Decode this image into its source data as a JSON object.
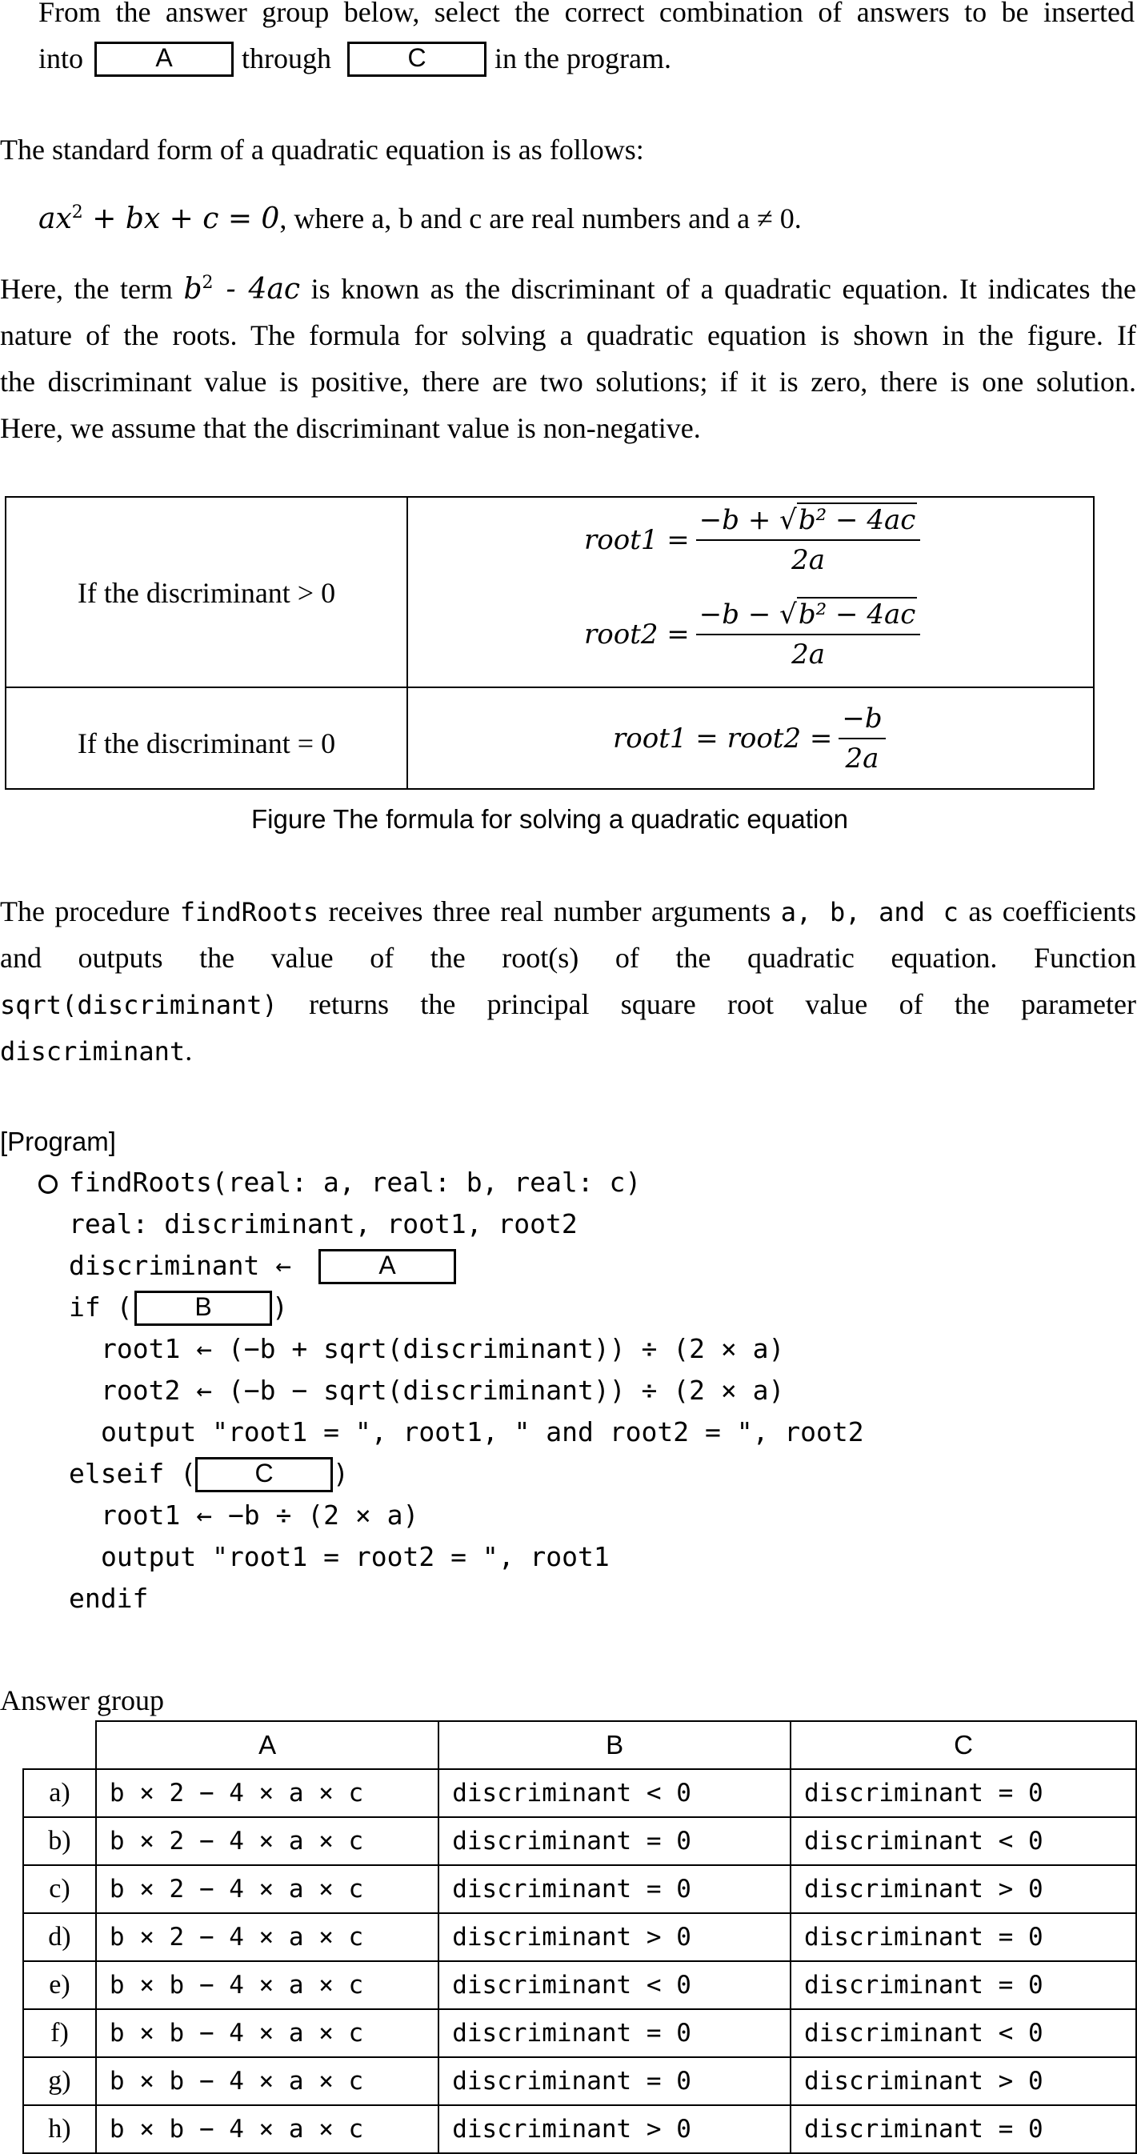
{
  "intro": {
    "line1": "From the answer group below, select the correct combination of answers to be inserted",
    "into": "into",
    "through": "through",
    "in_program": "in the program.",
    "blank_a": "A",
    "blank_c": "C"
  },
  "standard_form": {
    "heading": "The standard form of a quadratic equation is as follows:",
    "eq_text": ", where a, b and c are real numbers and a ≠ 0."
  },
  "discriminant_paragraph": {
    "line1_after": " is known as the discriminant of a quadratic equation. It indicates the",
    "line2": "nature of the roots. The formula for solving a quadratic equation is shown in the figure. If",
    "line3": "the discriminant value is positive, there are two solutions; if it is zero, there is one solution.",
    "line4": "Here, we assume that the discriminant value is non-negative."
  },
  "figure": {
    "row1_condition": "If the discriminant > 0",
    "row2_condition": "If the discriminant  = 0",
    "caption": "Figure  The formula for solving a quadratic equation"
  },
  "procedure_paragraph": {
    "line1_pre": "The procedure ",
    "name": "findRoots",
    "line1_mid": " receives three real number arguments ",
    "args": "a, b, and c",
    "line1_post": " as coefficients",
    "line2": "and outputs the value of the root(s) of the quadratic equation. Function",
    "line3_code": "sqrt(discriminant)",
    "line3": " returns the principal square root value of the parameter",
    "line4_code": "discriminant",
    "line4": "."
  },
  "program": {
    "label": "[Program]",
    "lines": [
      "findRoots(real: a, real: b, real: c)",
      "real: discriminant, root1, root2",
      "discriminant ←",
      "if (",
      ")",
      "root1 ← (−b + sqrt(discriminant)) ÷ (2 × a)",
      "root2 ← (−b − sqrt(discriminant)) ÷ (2 × a)",
      "output \"root1 = \", root1, \" and root2 = \", root2",
      "elseif (",
      ")",
      "root1 ← −b ÷ (2 × a)",
      "output \"root1 = root2 = \", root1",
      "endif"
    ],
    "blank_a": "A",
    "blank_b": "B",
    "blank_c": "C"
  },
  "answer_group": {
    "title": "Answer group",
    "headers": [
      "A",
      "B",
      "C"
    ],
    "rows": [
      {
        "label": "a)",
        "a": "b × 2 − 4 × a × c",
        "b": "discriminant < 0",
        "c": "discriminant = 0"
      },
      {
        "label": "b)",
        "a": "b × 2 − 4 × a × c",
        "b": "discriminant = 0",
        "c": "discriminant < 0"
      },
      {
        "label": "c)",
        "a": "b × 2 − 4 × a × c",
        "b": "discriminant = 0",
        "c": "discriminant > 0"
      },
      {
        "label": "d)",
        "a": "b × 2 − 4 × a × c",
        "b": "discriminant > 0",
        "c": "discriminant = 0"
      },
      {
        "label": "e)",
        "a": "b × b − 4 × a × c",
        "b": "discriminant < 0",
        "c": "discriminant = 0"
      },
      {
        "label": "f)",
        "a": "b × b − 4 × a × c",
        "b": "discriminant = 0",
        "c": "discriminant < 0"
      },
      {
        "label": "g)",
        "a": "b × b − 4 × a × c",
        "b": "discriminant = 0",
        "c": "discriminant > 0"
      },
      {
        "label": "h)",
        "a": "b × b − 4 × a × c",
        "b": "discriminant > 0",
        "c": "discriminant = 0"
      }
    ]
  }
}
